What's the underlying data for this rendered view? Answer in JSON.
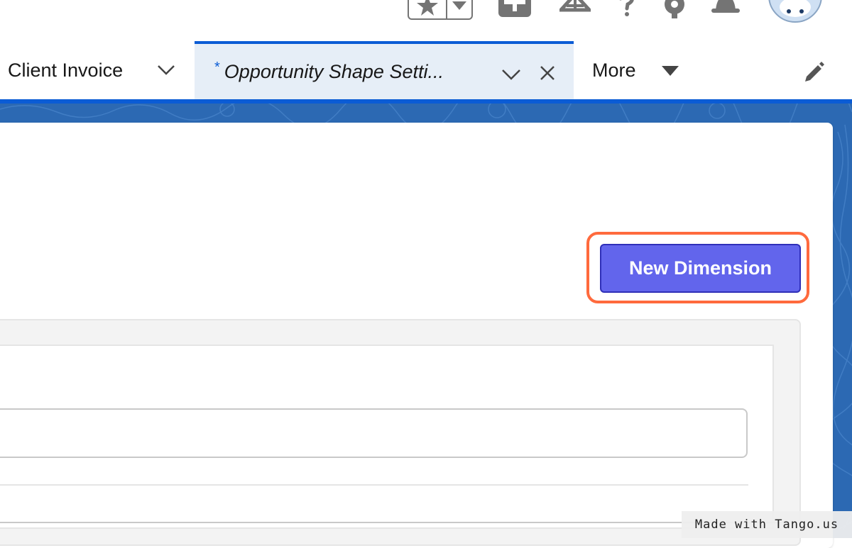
{
  "header": {
    "icons": [
      "star-icon",
      "chevron-down-icon",
      "plus-icon",
      "trailhead-icon",
      "help-icon",
      "gear-icon",
      "bell-icon",
      "avatar"
    ]
  },
  "tabs": {
    "client_invoice": {
      "label": "Client Invoice"
    },
    "opportunity": {
      "dirty_marker": "*",
      "label": "Opportunity Shape Setti..."
    },
    "more": {
      "label": "More"
    }
  },
  "main": {
    "new_dimension_label": "New Dimension"
  },
  "watermark": {
    "text": "Made with Tango.us"
  },
  "colors": {
    "brand_blue": "#0b5cd5",
    "button_purple": "#6265ec",
    "highlight_orange": "#ff6a3d",
    "active_tab_bg": "#e6eef7"
  }
}
